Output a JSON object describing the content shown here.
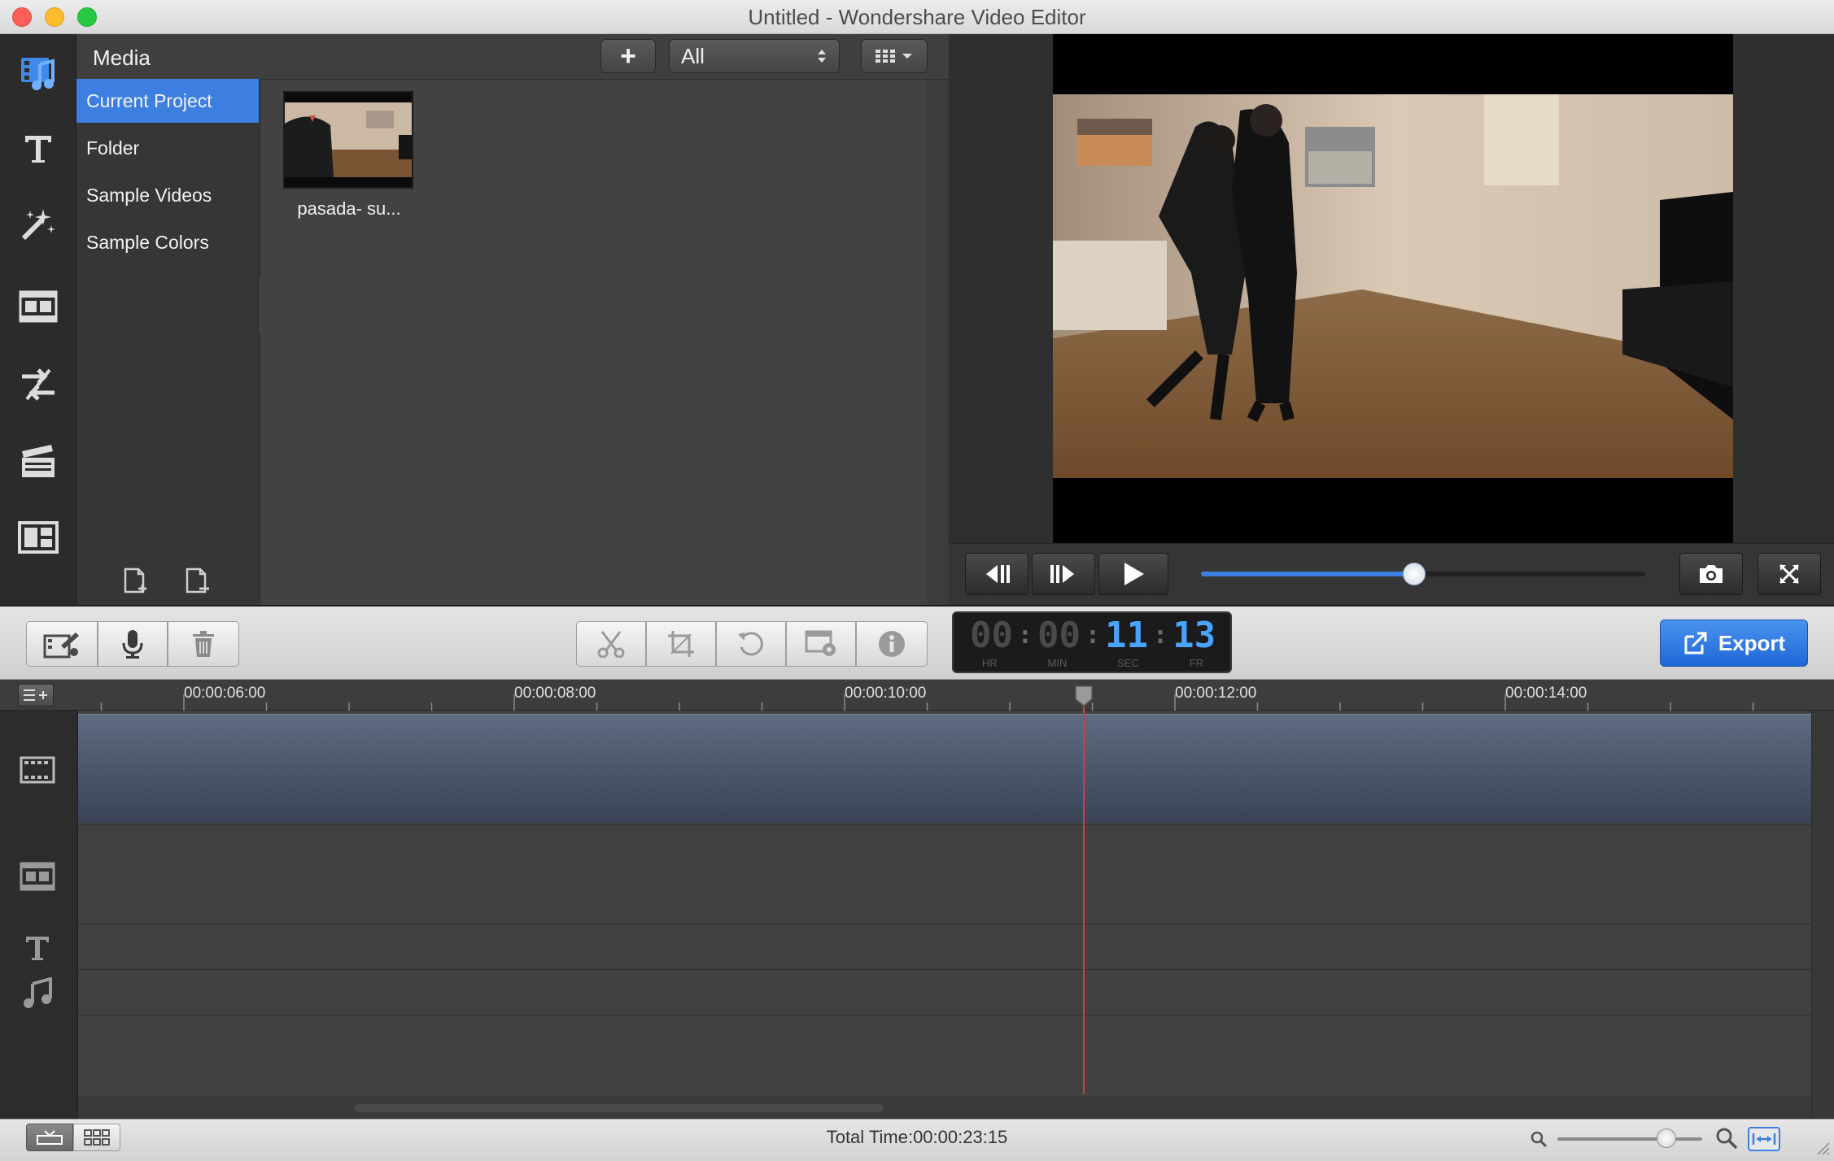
{
  "window": {
    "title": "Untitled - Wondershare Video Editor"
  },
  "sidebar": {
    "icons": [
      "media-icon",
      "text-icon",
      "effects-icon",
      "filters-icon",
      "transitions-icon",
      "intro-credit-icon",
      "pip-icon"
    ]
  },
  "media": {
    "header_label": "Media",
    "add_label": "+",
    "filter_value": "All",
    "categories": [
      {
        "label": "Current Project",
        "selected": true
      },
      {
        "label": "Folder"
      },
      {
        "label": "Sample Videos"
      },
      {
        "label": "Sample Colors"
      }
    ],
    "items": [
      {
        "label": "pasada- su..."
      }
    ]
  },
  "preview": {
    "progress": 0.48
  },
  "timecode": {
    "hours": "00",
    "minutes": "00",
    "seconds": "11",
    "frames": "13",
    "hr_label": "HR",
    "min_label": "MIN",
    "sec_label": "SEC",
    "fr_label": "FR"
  },
  "toolbar": {
    "export_label": "Export"
  },
  "timeline": {
    "ticks": [
      "00:00:06:00",
      "00:00:08:00",
      "00:00:10:00",
      "00:00:12:00",
      "00:00:14:00"
    ]
  },
  "status": {
    "total_time": "Total Time:00:00:23:15",
    "zoom_level": 0.75
  },
  "colors": {
    "accent": "#3d7fe0",
    "export": "#2a76e4",
    "playhead": "#d93a3a"
  }
}
